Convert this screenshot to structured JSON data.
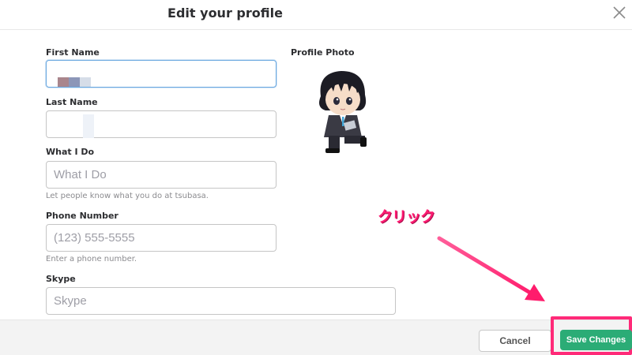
{
  "modal": {
    "title": "Edit your profile",
    "close_icon": "close-icon"
  },
  "form": {
    "first_name": {
      "label": "First Name",
      "value": ""
    },
    "last_name": {
      "label": "Last Name",
      "value": ""
    },
    "what_i_do": {
      "label": "What I Do",
      "placeholder": "What I Do",
      "help": "Let people know what you do at tsubasa."
    },
    "phone": {
      "label": "Phone Number",
      "placeholder": "(123) 555-5555",
      "help": "Enter a phone number."
    },
    "skype": {
      "label": "Skype",
      "placeholder": "Skype"
    }
  },
  "profile_photo": {
    "label": "Profile Photo",
    "image": "anime-character-avatar"
  },
  "annotation": {
    "text": "クリック",
    "color": "#ff1c72"
  },
  "footer": {
    "cancel_label": "Cancel",
    "save_label": "Save Changes"
  },
  "colors": {
    "accent_green": "#2bac76",
    "annotation_pink": "#ff2a78",
    "focus_blue": "#6aa8e0"
  }
}
